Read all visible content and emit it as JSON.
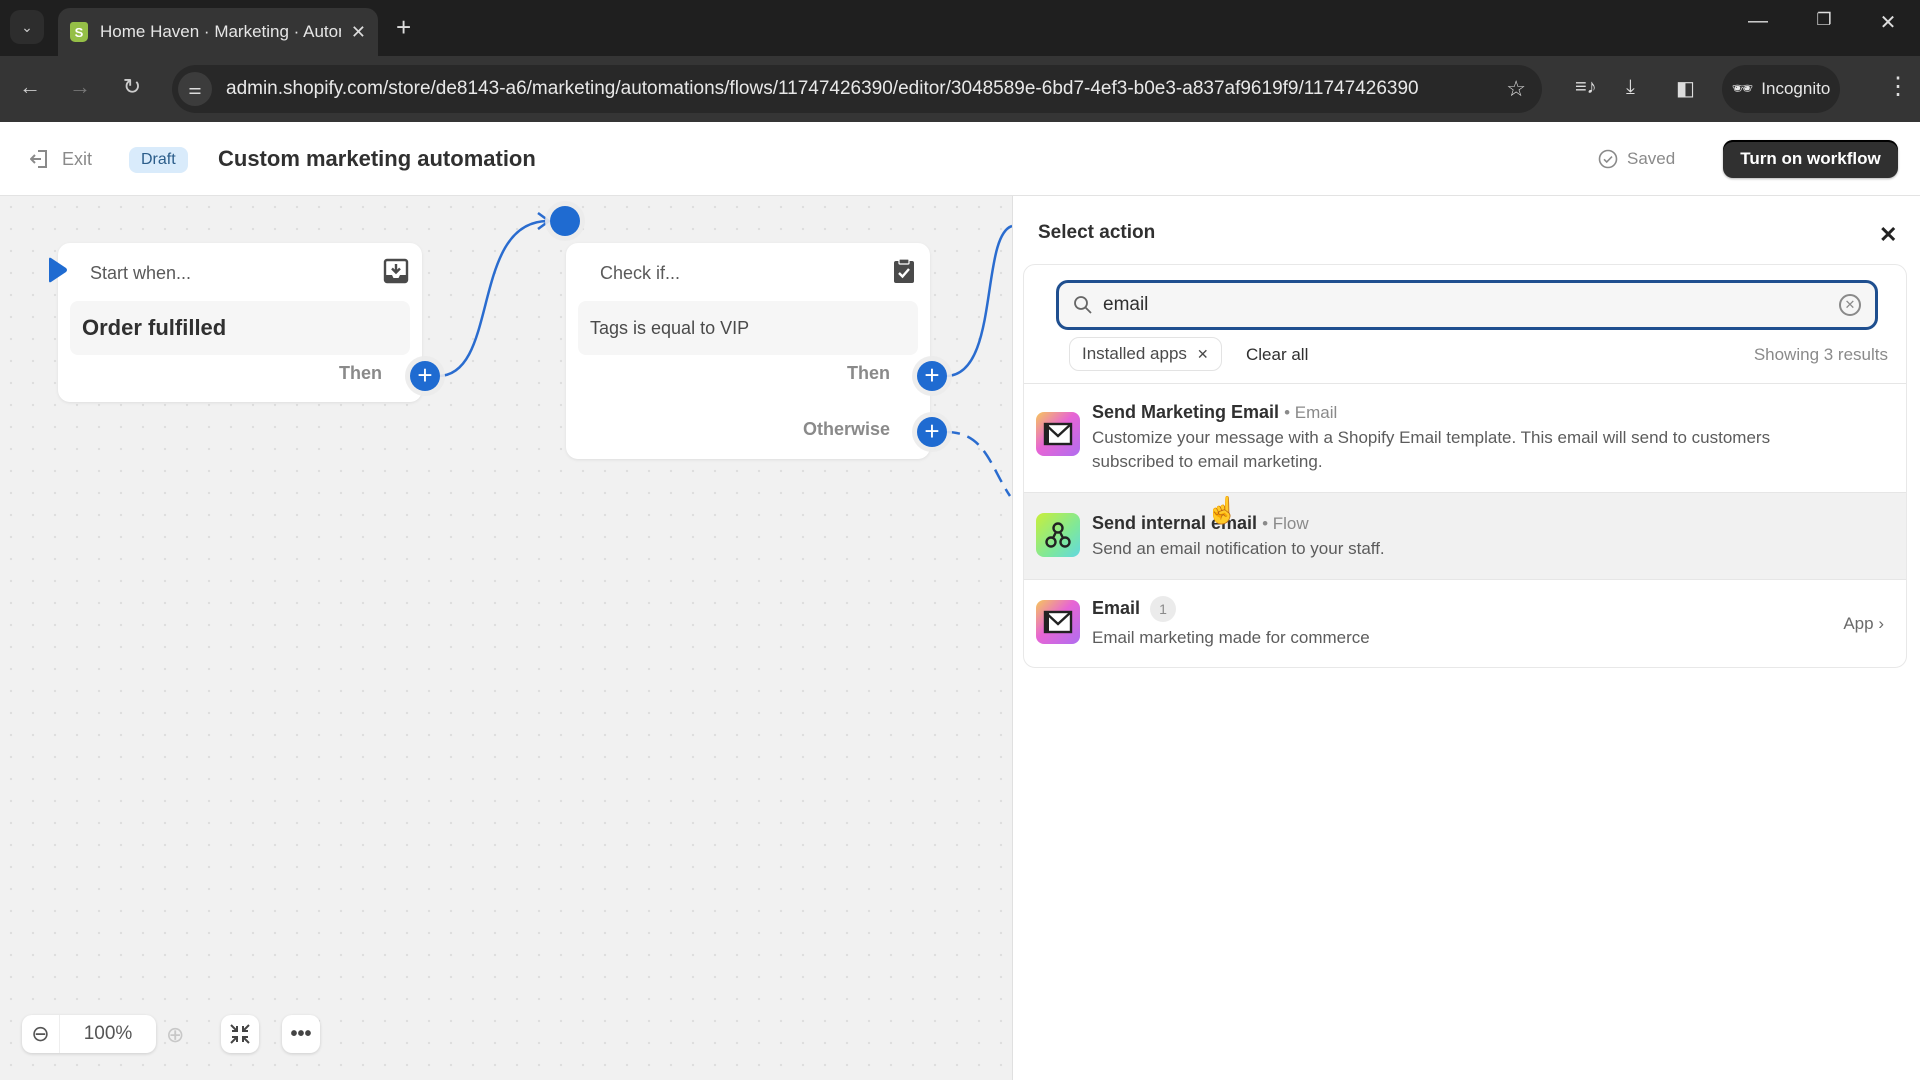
{
  "browser": {
    "tab_title": "Home Haven · Marketing · Automations",
    "url": "admin.shopify.com/store/de8143-a6/marketing/automations/flows/11747426390/editor/3048589e-6bd7-4ef3-b0e3-a837af9619f9/11747426390",
    "incognito_label": "Incognito"
  },
  "header": {
    "exit_label": "Exit",
    "status_badge": "Draft",
    "title": "Custom marketing automation",
    "saved_label": "Saved",
    "turn_on_label": "Turn on workflow"
  },
  "canvas": {
    "nodes": [
      {
        "head": "Start when...",
        "body": "Order fulfilled",
        "outputs": [
          "Then"
        ]
      },
      {
        "head": "Check if...",
        "body": "Tags is equal to VIP",
        "outputs": [
          "Then",
          "Otherwise"
        ]
      }
    ],
    "zoom_level": "100%"
  },
  "panel": {
    "title": "Select action",
    "search_value": "email",
    "filter_chip": "Installed apps",
    "clear_all_label": "Clear all",
    "results_count": "Showing 3 results",
    "results": [
      {
        "title": "Send Marketing Email",
        "source": "Email",
        "description": "Customize your message with a Shopify Email template. This email will send to customers subscribed to email marketing.",
        "icon": "email-app-icon"
      },
      {
        "title": "Send internal email",
        "source": "Flow",
        "description": "Send an email notification to your staff.",
        "icon": "flow-app-icon"
      },
      {
        "title": "Email",
        "badge": "1",
        "description": "Email marketing made for commerce",
        "trailing": "App",
        "icon": "email-app-icon"
      }
    ]
  },
  "colors": {
    "accent_blue": "#1f6bd1",
    "primary_button": "#303030",
    "draft_badge_bg": "#d9ebfb",
    "focus_ring": "#1f4f8f"
  }
}
